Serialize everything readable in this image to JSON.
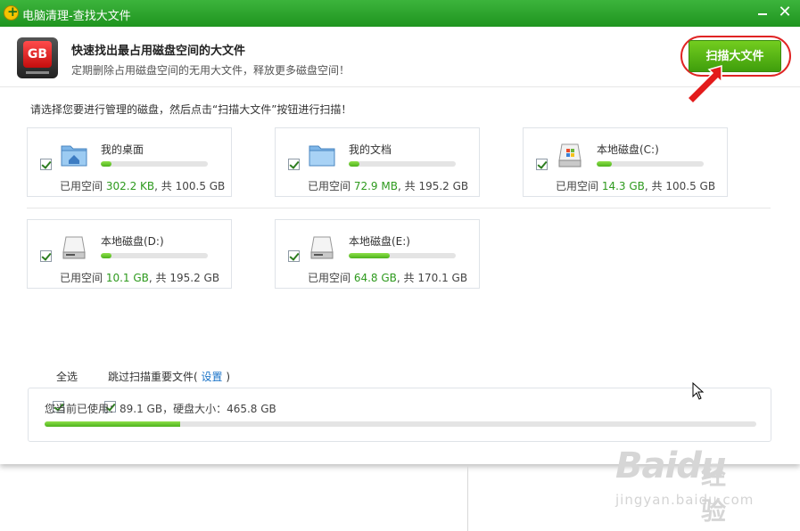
{
  "window": {
    "title": "电脑清理-查找大文件"
  },
  "header": {
    "icon_text": "GB",
    "title": "快速找出最占用磁盘空间的大文件",
    "subtitle": "定期删除占用磁盘空间的无用大文件，释放更多磁盘空间！",
    "scan_button": "扫描大文件"
  },
  "instruction": "请选择您要进行管理的磁盘，然后点击“扫描大文件”按钮进行扫描！",
  "drives": [
    {
      "name": "我的桌面",
      "used_label": "已用空间",
      "used": "302.2 KB",
      "sep": ", 共",
      "total": "100.5 GB",
      "fill_percent": 0.3,
      "icon": "desktop-folder-icon",
      "checked": true
    },
    {
      "name": "我的文档",
      "used_label": "已用空间",
      "used": "72.9 MB",
      "sep": ", 共",
      "total": "195.2 GB",
      "fill_percent": 0.3,
      "icon": "documents-folder-icon",
      "checked": true
    },
    {
      "name": "本地磁盘(C:)",
      "used_label": "已用空间",
      "used": "14.3 GB",
      "sep": ", 共",
      "total": "100.5 GB",
      "fill_percent": 14.2,
      "icon": "system-drive-icon",
      "checked": true
    },
    {
      "name": "本地磁盘(D:)",
      "used_label": "已用空间",
      "used": "10.1 GB",
      "sep": ", 共",
      "total": "195.2 GB",
      "fill_percent": 5.2,
      "icon": "hard-drive-icon",
      "checked": true
    },
    {
      "name": "本地磁盘(E:)",
      "used_label": "已用空间",
      "used": "64.8 GB",
      "sep": ", 共",
      "total": "170.1 GB",
      "fill_percent": 38.1,
      "icon": "hard-drive-icon",
      "checked": true
    }
  ],
  "options": {
    "select_all": "全选",
    "skip_label": "跳过扫描重要文件(",
    "settings_link": "设置",
    "skip_close": ")"
  },
  "summary": {
    "text": "您当前已使用：89.1 GB，硬盘大小：465.8 GB",
    "fill_percent": 19.1
  },
  "watermark": {
    "brand": "Baidu",
    "cn": "经验",
    "url": "jingyan.baidu.com"
  },
  "colors": {
    "titlebar": "#2aa22a",
    "accent_green": "#4db21c",
    "value_green": "#2e9a1e",
    "highlight_red": "#e02424",
    "link_blue": "#1a73c8"
  }
}
